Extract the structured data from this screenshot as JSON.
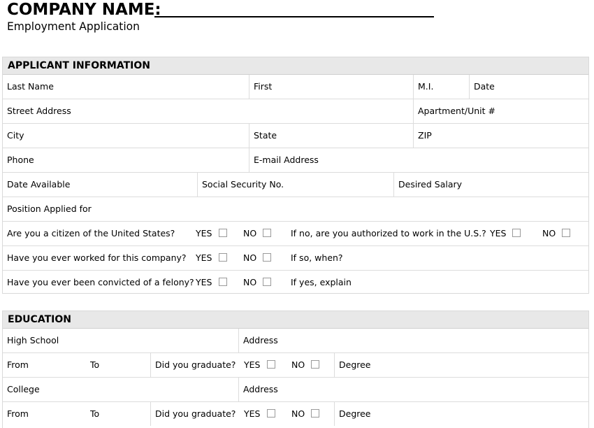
{
  "header": {
    "company_label": "COMPANY NAME:",
    "subtitle": "Employment Application"
  },
  "applicant": {
    "title": "APPLICANT INFORMATION",
    "last_name": "Last Name",
    "first": "First",
    "mi": "M.I.",
    "date": "Date",
    "street_address": "Street Address",
    "apartment_unit": "Apartment/Unit #",
    "city": "City",
    "state": "State",
    "zip": "ZIP",
    "phone": "Phone",
    "email": "E-mail Address",
    "date_available": "Date Available",
    "ssn": "Social Security No.",
    "desired_salary": "Desired Salary",
    "position": "Position Applied for",
    "citizen_q": "Are you a citizen of the United States?",
    "authorized_q": "If no, are you authorized to work in the U.S.?",
    "worked_q": "Have you ever worked for this company?",
    "if_so_when": "If so, when?",
    "felony_q": "Have you ever been convicted of a felony?",
    "if_yes_explain": "If yes, explain",
    "yes": "YES",
    "no": "NO"
  },
  "education": {
    "title": "EDUCATION",
    "high_school": "High School",
    "college": "College",
    "address": "Address",
    "from": "From",
    "to": "To",
    "graduate_q": "Did you graduate?",
    "yes": "YES",
    "no": "NO",
    "degree": "Degree"
  }
}
